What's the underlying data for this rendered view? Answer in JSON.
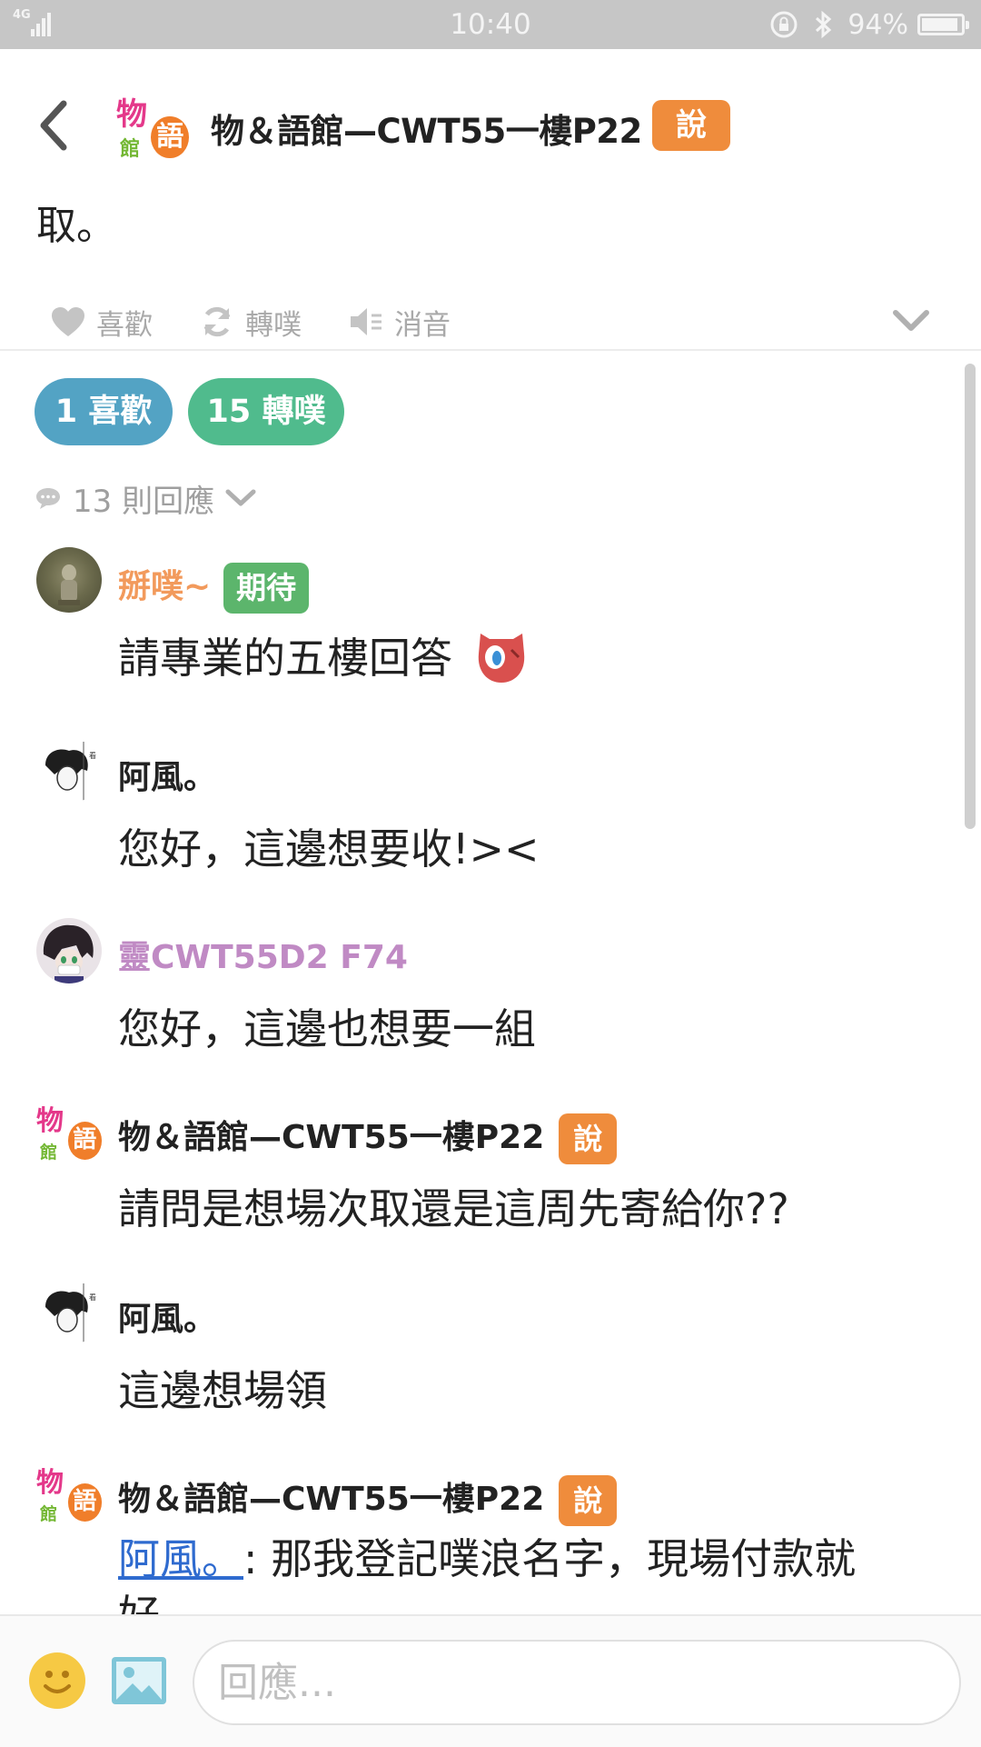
{
  "status_bar": {
    "network": "4G",
    "time": "10:40",
    "battery": "94%",
    "battery_level": 0.94
  },
  "header": {
    "plurker": "物＆語館—CWT55一樓P22",
    "qualifier": "說",
    "post_text": "取。",
    "actions": {
      "like": "喜歡",
      "replurk": "轉噗",
      "mute": "消音"
    }
  },
  "stats": {
    "likes": "1 喜歡",
    "replurks": "15 轉噗"
  },
  "responses_count": "13 則回應",
  "responses": [
    {
      "name": "掰噗~",
      "name_color": "#f29a5c",
      "qualifier": "期待",
      "qualifier_style": "green",
      "text": "請專業的五樓回答"
    },
    {
      "name": "阿風。",
      "name_color": "#222222",
      "text": "您好，這邊想要收!><"
    },
    {
      "name": "靈CWT55D2 F74",
      "name_color": "#c08ac4",
      "text": "您好，這邊也想要一組"
    },
    {
      "name": "物＆語館—CWT55一樓P22",
      "name_color": "#222222",
      "qualifier": "說",
      "qualifier_style": "orange",
      "text": "請問是想場次取還是這周先寄給你??"
    },
    {
      "name": "阿風。",
      "name_color": "#222222",
      "text": "這邊想場領"
    },
    {
      "name": "物＆語館—CWT55一樓P22",
      "name_color": "#222222",
      "qualifier": "說",
      "qualifier_style": "orange",
      "mention": "阿風。",
      "text": ": 那我登記噗浪名字，現場付款就",
      "text_cont": "好"
    }
  ],
  "reply": {
    "placeholder": "回應..."
  },
  "icons": {
    "back": "chevron-left-icon",
    "like": "heart-icon",
    "replurk": "refresh-icon",
    "mute": "speaker-mute-icon",
    "expand": "chevron-down-icon",
    "comment": "speech-bubble-icon",
    "emoji": "smiley-icon",
    "image": "image-icon"
  },
  "colors": {
    "like_pill": "#53a3c4",
    "replurk_pill": "#50bb8d",
    "qualifier_say": "#ef8c3c",
    "qualifier_expect": "#5cb56c",
    "link": "#2f6bcf"
  }
}
